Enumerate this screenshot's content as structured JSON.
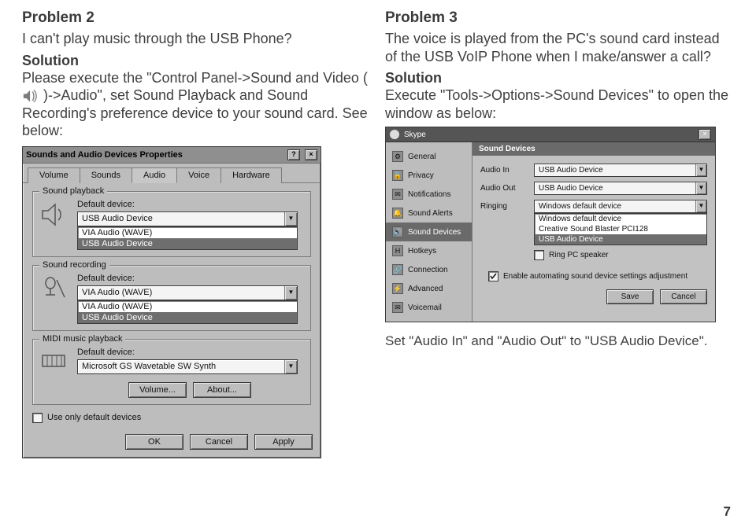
{
  "page_number": "7",
  "left": {
    "problem_heading": "Problem 2",
    "problem_text": "I can't play music through the USB Phone?",
    "solution_label": "Solution",
    "solution_pre": "Please execute the \"Control Panel->Sound and Video (",
    "solution_post": ")->Audio\", set Sound Playback and Sound Recording's preference device to your sound card. See below:",
    "dialog": {
      "title": "Sounds and Audio Devices Properties",
      "help_btn": "?",
      "close_btn": "×",
      "tabs": [
        "Volume",
        "Sounds",
        "Audio",
        "Voice",
        "Hardware"
      ],
      "active_tab": 2,
      "playback": {
        "group": "Sound playback",
        "label": "Default device:",
        "value": "USB Audio Device",
        "options": [
          "VIA Audio (WAVE)",
          "USB Audio Device"
        ]
      },
      "recording": {
        "group": "Sound recording",
        "label": "Default device:",
        "value": "VIA Audio (WAVE)",
        "options": [
          "VIA Audio (WAVE)",
          "USB Audio Device"
        ]
      },
      "midi": {
        "group": "MIDI music playback",
        "label": "Default device:",
        "value": "Microsoft GS Wavetable SW Synth"
      },
      "mid_buttons": {
        "volume": "Volume...",
        "about": "About..."
      },
      "use_only_default": "Use only default devices",
      "buttons": {
        "ok": "OK",
        "cancel": "Cancel",
        "apply": "Apply"
      }
    }
  },
  "right": {
    "problem_heading": "Problem 3",
    "problem_text": "The voice is played from the PC's sound card instead of the USB VoIP Phone when I make/answer a call?",
    "solution_label": "Solution",
    "solution_text": "Execute \"Tools->Options->Sound Devices\" to open the window as below:",
    "caption": "Set \"Audio In\" and \"Audio Out\" to \"USB Audio Device\".",
    "dialog": {
      "title": "Skype",
      "close_btn": "×",
      "side_items": [
        "General",
        "Privacy",
        "Notifications",
        "Sound Alerts",
        "Sound Devices",
        "Hotkeys",
        "Connection",
        "Advanced",
        "Voicemail"
      ],
      "side_icons": [
        "⚙",
        "🔒",
        "✉",
        "🔔",
        "🔊",
        "H",
        "🔗",
        "⚡",
        "✉"
      ],
      "active_side": 4,
      "panel_heading": "Sound Devices",
      "audio_in": {
        "label": "Audio In",
        "value": "USB Audio Device"
      },
      "audio_out": {
        "label": "Audio Out",
        "value": "USB Audio Device"
      },
      "ringing": {
        "label": "Ringing",
        "value": "Windows default device",
        "options": [
          "Windows default device",
          "Creative Sound Blaster PCI128",
          "USB Audio Device"
        ]
      },
      "ring_speaker": "Ring PC speaker",
      "auto_adjust": "Enable automating sound device settings adjustment",
      "buttons": {
        "save": "Save",
        "cancel": "Cancel"
      }
    }
  }
}
